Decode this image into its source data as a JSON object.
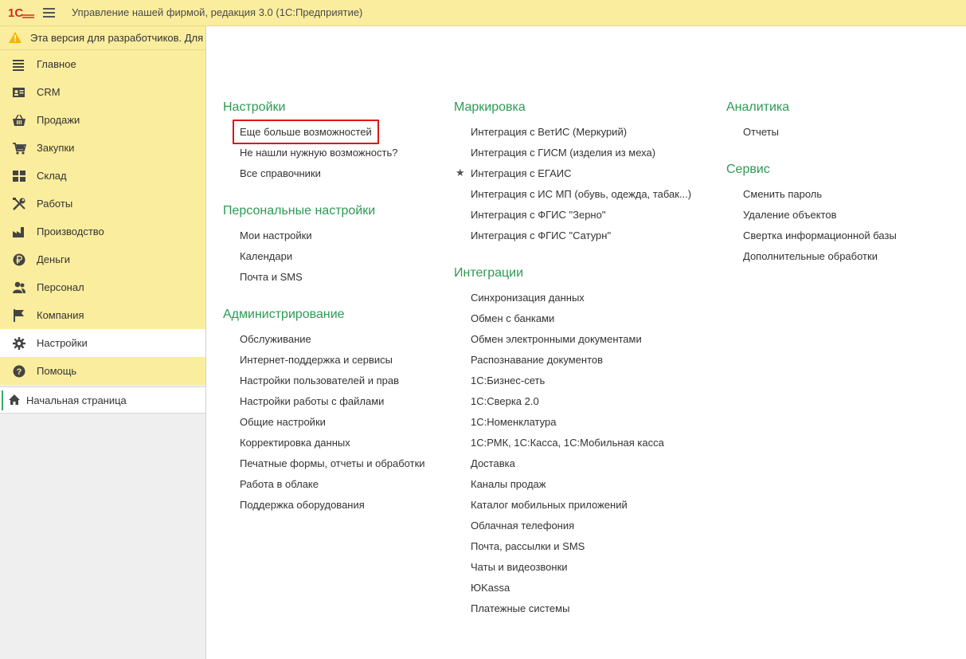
{
  "window": {
    "title": "Управление нашей фирмой, редакция 3.0  (1С:Предприятие)"
  },
  "banner": {
    "text": "Эта версия для разработчиков. Для использования в работе необходимо приобрести"
  },
  "sidebar": {
    "items": [
      {
        "label": "Главное",
        "icon": "menu-lines-icon"
      },
      {
        "label": "CRM",
        "icon": "contact-card-icon"
      },
      {
        "label": "Продажи",
        "icon": "basket-icon"
      },
      {
        "label": "Закупки",
        "icon": "cart-icon"
      },
      {
        "label": "Склад",
        "icon": "grid-icon"
      },
      {
        "label": "Работы",
        "icon": "tools-icon"
      },
      {
        "label": "Производство",
        "icon": "factory-icon"
      },
      {
        "label": "Деньги",
        "icon": "ruble-icon"
      },
      {
        "label": "Персонал",
        "icon": "people-icon"
      },
      {
        "label": "Компания",
        "icon": "flag-icon"
      },
      {
        "label": "Настройки",
        "icon": "gear-icon",
        "active": true
      },
      {
        "label": "Помощь",
        "icon": "help-icon"
      }
    ],
    "home": "Начальная страница"
  },
  "main": {
    "nastroiki": {
      "title": "Настройки",
      "links": [
        "Еще больше возможностей",
        "Не нашли нужную возможность?",
        "Все справочники"
      ]
    },
    "personal": {
      "title": "Персональные настройки",
      "links": [
        "Мои настройки",
        "Календари",
        "Почта и SMS"
      ]
    },
    "admin": {
      "title": "Администрирование",
      "links": [
        "Обслуживание",
        "Интернет-поддержка и сервисы",
        "Настройки пользователей и прав",
        "Настройки работы с файлами",
        "Общие настройки",
        "Корректировка данных",
        "Печатные формы, отчеты и обработки",
        "Работа в облаке",
        "Поддержка оборудования"
      ]
    },
    "markirovka": {
      "title": "Маркировка",
      "links": [
        "Интеграция с ВетИС (Меркурий)",
        "Интеграция с ГИСМ (изделия из меха)",
        "Интеграция с ЕГАИС",
        "Интеграция с ИС МП (обувь, одежда, табак...)",
        "Интеграция с ФГИС \"Зерно\"",
        "Интеграция с ФГИС \"Сатурн\""
      ],
      "starred_index": 2
    },
    "integracii": {
      "title": "Интеграции",
      "links": [
        "Синхронизация данных",
        "Обмен с банками",
        "Обмен электронными документами",
        "Распознавание документов",
        "1С:Бизнес-сеть",
        "1С:Сверка 2.0",
        "1С:Номенклатура",
        "1С:РМК, 1С:Касса, 1С:Мобильная касса",
        "Доставка",
        "Каналы продаж",
        "Каталог мобильных приложений",
        "Облачная телефония",
        "Почта, рассылки и SMS",
        "Чаты и видеозвонки",
        "ЮKassa",
        "Платежные системы"
      ]
    },
    "analitika": {
      "title": "Аналитика",
      "links": [
        "Отчеты"
      ]
    },
    "servis": {
      "title": "Сервис",
      "links": [
        "Сменить пароль",
        "Удаление объектов",
        "Свертка информационной базы",
        "Дополнительные обработки"
      ]
    }
  },
  "colors": {
    "accent_yellow": "#fbed9e",
    "group_title_green": "#2e9a54",
    "highlight_red": "#e01515"
  }
}
